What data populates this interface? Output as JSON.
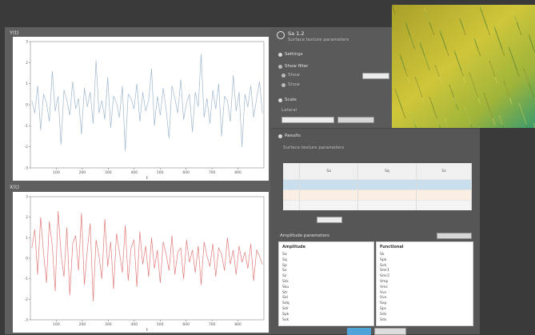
{
  "left_panel": {
    "top_chart": {
      "title": "Y(t)",
      "ylabel": "",
      "xlabel": "t"
    },
    "bottom_chart": {
      "title": "X(t)",
      "ylabel": "",
      "xlabel": "t"
    }
  },
  "settings": {
    "header_title": "Sa 1.2",
    "header_subtitle": "Surface texture parameters",
    "section_1": "Settings",
    "option_1": "Show filter",
    "option_2": "Show",
    "option_3": "Show",
    "section_2": "Scale",
    "label_2": "Lateral",
    "field_value": "",
    "dropdown_value": "",
    "button_label": ""
  },
  "results": {
    "section_title": "Results",
    "subtitle": "Surface texture parameters",
    "headers": [
      "",
      "Sa",
      "Sq",
      "Sz"
    ],
    "rows": [
      [
        "",
        "",
        "",
        ""
      ],
      [
        "",
        "",
        "",
        ""
      ],
      [
        "",
        "",
        "",
        ""
      ]
    ],
    "small_label": "",
    "small_field": ""
  },
  "params": {
    "section_title": "Amplitude parameters",
    "right_button": "",
    "left_title": "Amplitude",
    "right_title": "Functional",
    "left_rows": [
      {
        "name": "Sa",
        "value": ""
      },
      {
        "name": "Sq",
        "value": ""
      },
      {
        "name": "Sp",
        "value": ""
      },
      {
        "name": "Sv",
        "value": ""
      },
      {
        "name": "Sz",
        "value": ""
      },
      {
        "name": "Ssk",
        "value": ""
      },
      {
        "name": "Sku",
        "value": ""
      },
      {
        "name": "Str",
        "value": ""
      },
      {
        "name": "Sal",
        "value": ""
      },
      {
        "name": "Sdq",
        "value": ""
      },
      {
        "name": "Sdr",
        "value": ""
      },
      {
        "name": "Spk",
        "value": ""
      },
      {
        "name": "Svk",
        "value": ""
      }
    ],
    "right_rows": [
      {
        "name": "Sk",
        "value": ""
      },
      {
        "name": "Spk",
        "value": ""
      },
      {
        "name": "Svk",
        "value": ""
      },
      {
        "name": "Smr1",
        "value": ""
      },
      {
        "name": "Smr2",
        "value": ""
      },
      {
        "name": "Vmp",
        "value": ""
      },
      {
        "name": "Vmc",
        "value": ""
      },
      {
        "name": "Vvc",
        "value": ""
      },
      {
        "name": "Vvv",
        "value": ""
      },
      {
        "name": "Sxp",
        "value": ""
      },
      {
        "name": "Spc",
        "value": ""
      },
      {
        "name": "Sds",
        "value": ""
      },
      {
        "name": "Sdv",
        "value": ""
      }
    ]
  },
  "footer": {
    "primary": "",
    "secondary": ""
  },
  "chart_data": [
    {
      "type": "line",
      "title": "Y(t)",
      "xlabel": "t",
      "ylabel": "",
      "xlim": [
        0,
        900
      ],
      "ylim": [
        -3,
        3
      ],
      "x_ticks": [
        100,
        200,
        300,
        400,
        500,
        600,
        700,
        800
      ],
      "y_ticks": [
        -3,
        -2,
        -1,
        0,
        1,
        2,
        3
      ],
      "series": [
        {
          "color": "#9fb8cf",
          "values": [
            0.2,
            -0.4,
            0.9,
            -1.2,
            0.5,
            0.1,
            -0.8,
            1.6,
            -0.3,
            0.4,
            -1.9,
            0.7,
            0.2,
            -0.5,
            1.1,
            -0.2,
            0.3,
            -1.4,
            0.8,
            -0.1,
            0.6,
            -0.9,
            2.1,
            -0.4,
            0.2,
            -0.7,
            1.3,
            -1.1,
            0.4,
            0.1,
            -0.6,
            0.9,
            -2.2,
            0.5,
            0.3,
            -0.2,
            1.0,
            -0.8,
            0.6,
            -0.3,
            0.2,
            1.7,
            -1.0,
            0.4,
            -0.5,
            0.8,
            -0.2,
            -1.6,
            0.9,
            0.3,
            -0.4,
            1.2,
            -0.7,
            0.1,
            0.5,
            -1.3,
            0.6,
            -0.1,
            2.4,
            -0.6,
            0.3,
            -0.9,
            0.7,
            -0.2,
            1.0,
            -1.5,
            0.4,
            0.2,
            -0.8,
            1.4,
            -0.3,
            0.6,
            -2.0,
            0.5,
            -0.1,
            0.9,
            -0.6,
            0.3,
            1.1,
            -0.4
          ]
        }
      ]
    },
    {
      "type": "line",
      "title": "X(t)",
      "xlabel": "t",
      "ylabel": "",
      "xlim": [
        0,
        900
      ],
      "ylim": [
        -3,
        3
      ],
      "x_ticks": [
        100,
        200,
        300,
        400,
        500,
        600,
        700,
        800
      ],
      "y_ticks": [
        -3,
        -2,
        -1,
        0,
        1,
        2,
        3
      ],
      "series": [
        {
          "color": "#e07a7a",
          "values": [
            0.5,
            1.4,
            -0.8,
            2.0,
            0.3,
            -1.2,
            1.8,
            0.6,
            -1.6,
            2.3,
            0.2,
            -0.9,
            1.5,
            -1.8,
            0.7,
            1.1,
            -0.6,
            2.2,
            -1.3,
            0.4,
            1.7,
            -2.1,
            0.9,
            0.1,
            -1.0,
            1.9,
            -0.4,
            0.8,
            -1.5,
            1.2,
            0.3,
            -0.7,
            1.6,
            -1.1,
            0.5,
            0.9,
            -1.4,
            1.3,
            -0.3,
            0.6,
            -0.9,
            1.0,
            -0.5,
            0.4,
            -1.2,
            0.8,
            0.2,
            -0.6,
            1.1,
            -0.8,
            0.3,
            0.5,
            -1.0,
            0.9,
            -0.2,
            0.4,
            -0.7,
            0.6,
            -1.3,
            0.8,
            0.1,
            -0.4,
            0.7,
            -0.9,
            0.5,
            0.2,
            -0.6,
            1.0,
            -0.3,
            0.4,
            -0.8,
            0.6,
            -0.2,
            0.3,
            -0.5,
            0.7,
            -1.1,
            0.4,
            0.1,
            -0.3
          ]
        }
      ]
    }
  ]
}
